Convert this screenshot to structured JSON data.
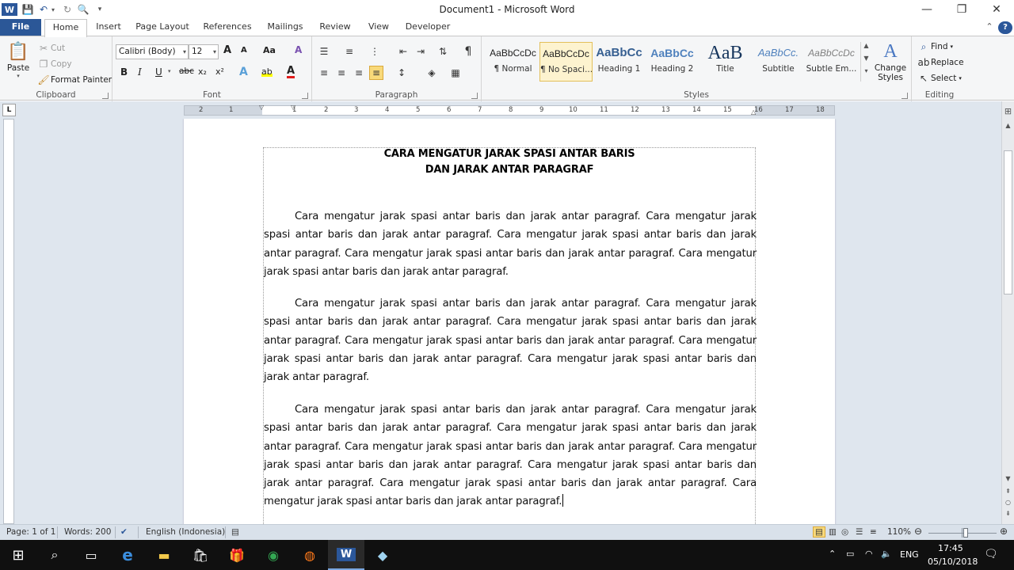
{
  "window": {
    "title": "Document1 - Microsoft Word",
    "app_icon": "W",
    "controls": {
      "minimize": "—",
      "restore": "❐",
      "close": "✕"
    }
  },
  "quick_access": {
    "icons": [
      "save-icon",
      "undo-icon",
      "redo-icon",
      "print-preview-icon",
      "customize-qat-icon"
    ]
  },
  "tabs": [
    {
      "label": "File"
    },
    {
      "label": "Home"
    },
    {
      "label": "Insert"
    },
    {
      "label": "Page Layout"
    },
    {
      "label": "References"
    },
    {
      "label": "Mailings"
    },
    {
      "label": "Review"
    },
    {
      "label": "View"
    },
    {
      "label": "Developer"
    }
  ],
  "ribbon": {
    "clipboard": {
      "label": "Clipboard",
      "paste": "Paste",
      "cut": "Cut",
      "copy": "Copy",
      "format_painter": "Format Painter"
    },
    "font": {
      "label": "Font",
      "font_name": "Calibri (Body)",
      "font_size": "12",
      "buttons": {
        "bold": "B",
        "italic": "I",
        "underline": "U",
        "strike": "abc",
        "subscript": "x₂",
        "superscript": "x²",
        "grow": "A",
        "shrink": "A",
        "case": "Aa",
        "clear": "A",
        "highlight": "ab",
        "font_color": "A"
      }
    },
    "paragraph": {
      "label": "Paragraph",
      "show_hide": "¶"
    },
    "styles": {
      "label": "Styles",
      "items": [
        {
          "preview": "AaBbCcDc",
          "name": "¶ Normal"
        },
        {
          "preview": "AaBbCcDc",
          "name": "¶ No Spaci..."
        },
        {
          "preview": "AaBbCc",
          "name": "Heading 1"
        },
        {
          "preview": "AaBbCc",
          "name": "Heading 2"
        },
        {
          "preview": "AaB",
          "name": "Title"
        },
        {
          "preview": "AaBbCc.",
          "name": "Subtitle"
        },
        {
          "preview": "AaBbCcDc",
          "name": "Subtle Em..."
        }
      ],
      "change_styles_1": "Change",
      "change_styles_2": "Styles"
    },
    "editing": {
      "label": "Editing",
      "find": "Find",
      "replace": "Replace",
      "select": "Select"
    }
  },
  "ruler": {
    "corner": "L",
    "numbers": [
      "2",
      "1",
      "1",
      "2",
      "3",
      "4",
      "5",
      "6",
      "7",
      "8",
      "9",
      "10",
      "11",
      "12",
      "13",
      "14",
      "15",
      "16",
      "17",
      "18"
    ]
  },
  "document": {
    "title_line_1": "CARA MENGATUR JARAK SPASI ANTAR BARIS",
    "title_line_2": "DAN JARAK ANTAR PARAGRAF",
    "paragraphs": [
      "Cara mengatur jarak spasi antar baris dan jarak antar paragraf. Cara mengatur jarak spasi antar baris dan jarak antar paragraf. Cara mengatur jarak spasi antar baris dan jarak antar paragraf. Cara mengatur jarak spasi antar baris dan jarak antar paragraf. Cara mengatur jarak spasi antar baris dan jarak antar paragraf.",
      "Cara mengatur jarak spasi antar baris dan jarak antar paragraf. Cara mengatur jarak spasi antar baris dan jarak antar paragraf. Cara mengatur jarak spasi antar baris dan jarak antar paragraf. Cara mengatur jarak spasi antar baris dan jarak antar paragraf. Cara mengatur jarak spasi antar baris dan jarak antar paragraf. Cara mengatur jarak spasi antar baris dan jarak antar paragraf.",
      "Cara mengatur jarak spasi antar baris dan jarak antar paragraf. Cara mengatur jarak spasi antar baris dan jarak antar paragraf. Cara mengatur jarak spasi antar baris dan jarak antar paragraf. Cara mengatur jarak spasi antar baris dan jarak antar paragraf. Cara mengatur jarak spasi antar baris dan jarak antar paragraf. Cara mengatur jarak spasi antar baris dan jarak antar paragraf. Cara mengatur jarak spasi antar baris dan jarak antar paragraf. Cara mengatur jarak spasi antar baris dan jarak antar paragraf."
    ]
  },
  "status": {
    "page": "Page: 1 of 1",
    "words": "Words: 200",
    "language": "English (Indonesia)",
    "zoom": "110%",
    "zoom_level": 0.55
  },
  "taskbar": {
    "language": "ENG",
    "time": "17:45",
    "date": "05/10/2018"
  },
  "colors": {
    "file_tab": "#2b5797",
    "ribbon_bg": "#f5f6f7",
    "workspace_bg": "#dfe6ee",
    "taskbar_bg": "#101010",
    "selected_style": "#fdf3cf"
  }
}
